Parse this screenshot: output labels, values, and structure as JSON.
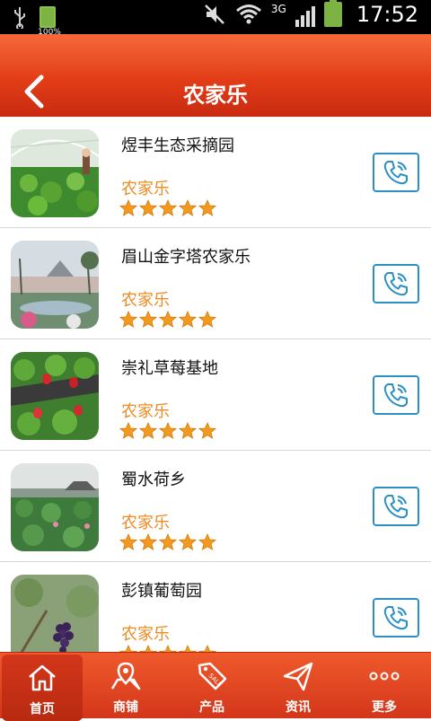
{
  "status_bar": {
    "battery_small_label": "100%",
    "network": "3G",
    "time": "17:52"
  },
  "header": {
    "title": "农家乐"
  },
  "items": [
    {
      "name": "煜丰生态采摘园",
      "category": "农家乐",
      "rating": 5
    },
    {
      "name": "眉山金字塔农家乐",
      "category": "农家乐",
      "rating": 5
    },
    {
      "name": "崇礼草莓基地",
      "category": "农家乐",
      "rating": 5
    },
    {
      "name": "蜀水荷乡",
      "category": "农家乐",
      "rating": 5
    },
    {
      "name": "彭镇葡萄园",
      "category": "农家乐",
      "rating": 5
    }
  ],
  "bottom_nav": {
    "tabs": [
      {
        "label": "首页",
        "icon": "home-icon",
        "active": true
      },
      {
        "label": "商铺",
        "icon": "map-icon",
        "active": false
      },
      {
        "label": "产品",
        "icon": "sale-tag-icon",
        "active": false
      },
      {
        "label": "资讯",
        "icon": "send-icon",
        "active": false
      },
      {
        "label": "更多",
        "icon": "more-icon",
        "active": false
      }
    ]
  },
  "colors": {
    "header_red": "#e23d17",
    "accent_orange": "#f08a21",
    "star_orange": "#f39a1e",
    "phone_blue": "#2b8fc3"
  }
}
